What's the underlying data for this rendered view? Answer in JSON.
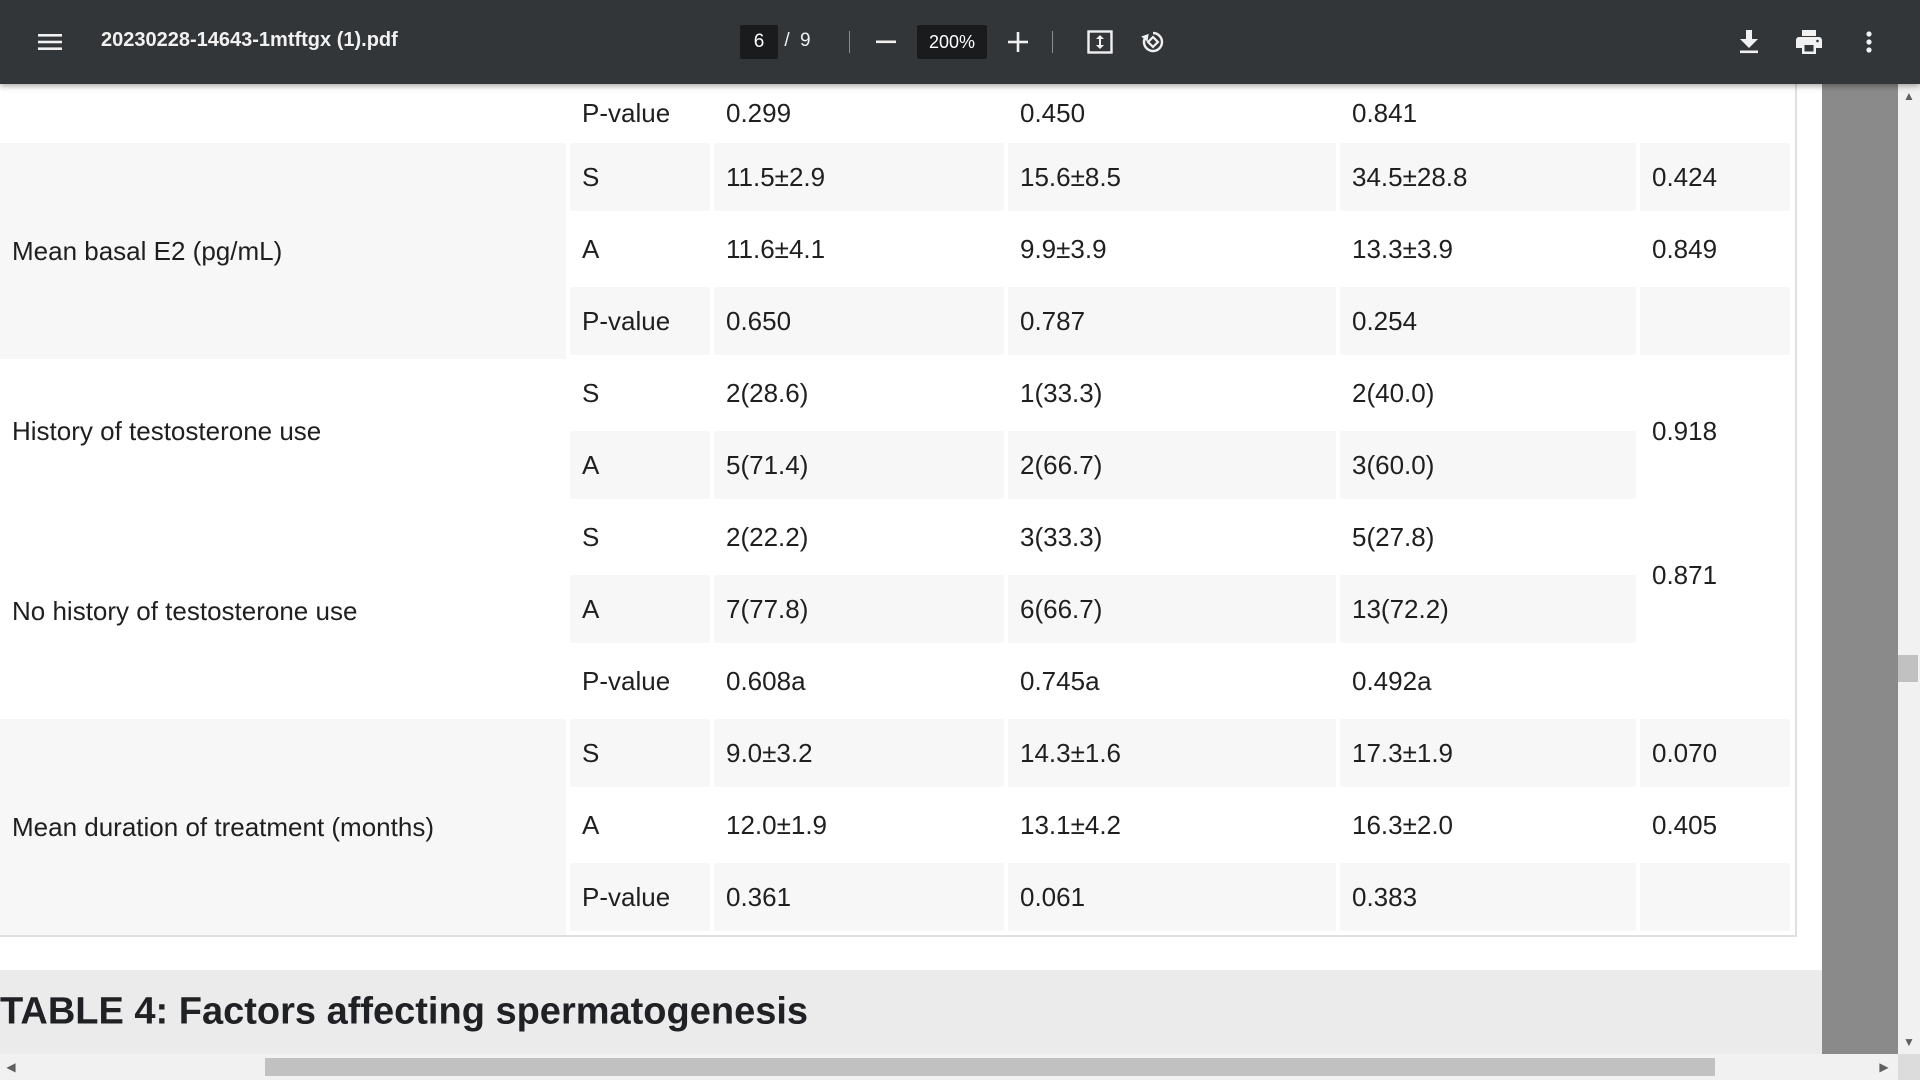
{
  "toolbar": {
    "file_name": "20230228-14643-1mtftgx (1).pdf",
    "current_page": "6",
    "page_separator": "/",
    "total_pages": "9",
    "zoom": "200%",
    "background_color": "#323639"
  },
  "table": {
    "top_row": {
      "group": "P-value",
      "c1": "0.299",
      "c2": "0.450",
      "c3": "0.841",
      "p": ""
    },
    "sections": [
      {
        "label": "Mean basal E2 (pg/mL)",
        "rows": [
          {
            "group": "S",
            "c1": "11.5±2.9",
            "c2": "15.6±8.5",
            "c3": "34.5±28.8",
            "p": "0.424"
          },
          {
            "group": "A",
            "c1": "11.6±4.1",
            "c2": "9.9±3.9",
            "c3": "13.3±3.9",
            "p": "0.849"
          },
          {
            "group": "P-value",
            "c1": "0.650",
            "c2": "0.787",
            "c3": "0.254",
            "p": ""
          }
        ]
      },
      {
        "label": "History of testosterone use",
        "rows": [
          {
            "group": "S",
            "c1": "2(28.6)",
            "c2": "1(33.3)",
            "c3": "2(40.0)"
          },
          {
            "group": "A",
            "c1": "5(71.4)",
            "c2": "2(66.7)",
            "c3": "3(60.0)"
          }
        ],
        "p": "0.918"
      },
      {
        "label": "No history of testosterone use",
        "rows": [
          {
            "group": "S",
            "c1": "2(22.2)",
            "c2": "3(33.3)",
            "c3": "5(27.8)"
          },
          {
            "group": "A",
            "c1": "7(77.8)",
            "c2": "6(66.7)",
            "c3": "13(72.2)"
          },
          {
            "group": "P-value",
            "c1": "0.608a",
            "c2": "0.745a",
            "c3": "0.492a"
          }
        ],
        "p": "0.871"
      },
      {
        "label": "Mean duration of treatment (months)",
        "rows": [
          {
            "group": "S",
            "c1": "9.0±3.2",
            "c2": "14.3±1.6",
            "c3": "17.3±1.9",
            "p": "0.070"
          },
          {
            "group": "A",
            "c1": "12.0±1.9",
            "c2": "13.1±4.2",
            "c3": "16.3±2.0",
            "p": "0.405"
          },
          {
            "group": "P-value",
            "c1": "0.361",
            "c2": "0.061",
            "c3": "0.383",
            "p": ""
          }
        ]
      }
    ]
  },
  "section_title": "TABLE 4: Factors affecting spermatogenesis",
  "scrollbars": {
    "up_arrow": "▲",
    "down_arrow": "▼",
    "left_arrow": "◀",
    "right_arrow": "▶"
  }
}
